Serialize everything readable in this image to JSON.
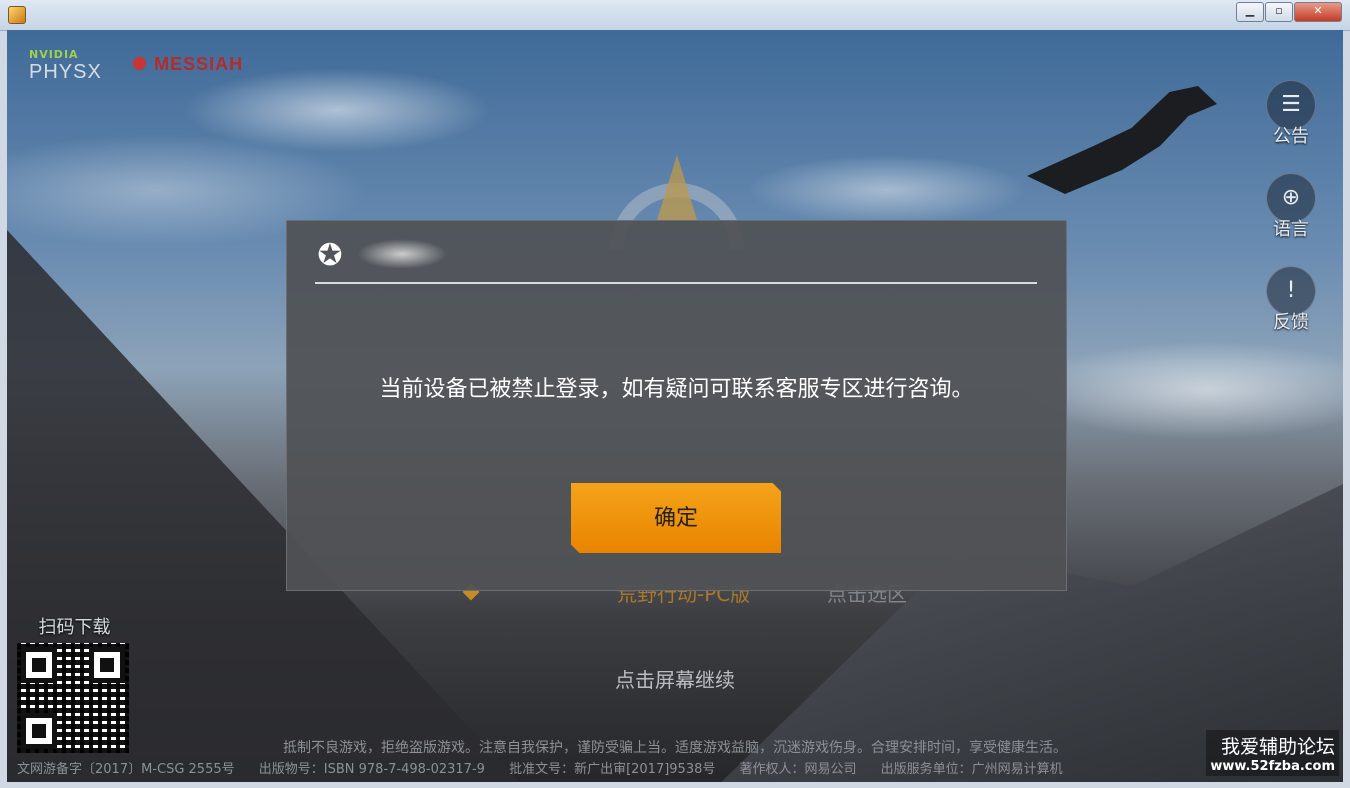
{
  "window": {
    "minimize": "▁",
    "restore": "▫",
    "close": "✕"
  },
  "brands": {
    "nvidia": "NVIDIA",
    "physx": "PHYSX",
    "messiah": "MESSIAH"
  },
  "side_buttons": [
    {
      "label": "公告",
      "icon": "notice-icon",
      "glyph": "☰"
    },
    {
      "label": "语言",
      "icon": "globe-icon",
      "glyph": "⊕"
    },
    {
      "label": "反馈",
      "icon": "feedback-icon",
      "glyph": "!"
    }
  ],
  "dialog": {
    "message": "当前设备已被禁止登录，如有疑问可联系客服专区进行咨询。",
    "ok_label": "确定",
    "logo_glyph": "✪"
  },
  "game": {
    "server_name": "荒野行动-PC版",
    "select_server": "点击选区",
    "continue_hint": "点击屏幕继续"
  },
  "qr": {
    "label": "扫码下载"
  },
  "footer": {
    "health_notice": "抵制不良游戏，拒绝盗版游戏。注意自我保护，谨防受骗上当。适度游戏益脑，沉迷游戏伤身。合理安排时间，享受健康生活。",
    "license": "文网游备字〔2017〕M-CSG 2555号",
    "publication": "出版物号：ISBN 978-7-498-02317-9",
    "approval": "批准文号：新广出审[2017]9538号",
    "copyright": "著作权人：网易公司",
    "publisher": "出版服务单位：广州网易计算机"
  },
  "watermark": {
    "line1": "我爱辅助论坛",
    "line2": "www.52fzba.com"
  },
  "colors": {
    "accent": "#e98400",
    "dialog_bg": "#505255"
  }
}
